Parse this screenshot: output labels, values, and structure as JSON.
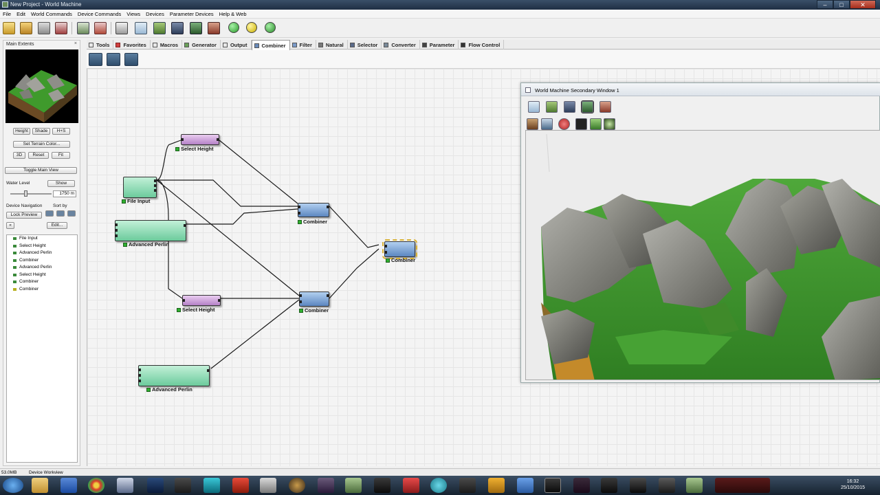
{
  "window": {
    "title": "New Project - World Machine"
  },
  "menu": [
    "File",
    "Edit",
    "World Commands",
    "Device Commands",
    "Views",
    "Devices",
    "Parameter Devices",
    "Help & Web"
  ],
  "left_panel": {
    "title": "Main Extents",
    "buttons": {
      "height": "Height",
      "shade": "Shade",
      "hs": "H+S",
      "set_terrain_color": "Set Terrain Color...",
      "b3d": "3D",
      "reset": "Reset",
      "fit": "Fit",
      "toggle_main_view": "Toggle Main View",
      "show": "Show",
      "lock_preview": "Lock Preview",
      "edit": "Edit..."
    },
    "water_level_label": "Water Level",
    "water_level_value": "1750 m",
    "device_navigation_label": "Device Navigation",
    "sort_by_label": "Sort by",
    "device_list": [
      "File Input",
      "Select Height",
      "Advanced Perlin",
      "Combiner",
      "Advanced Perlin",
      "Select Height",
      "Combiner",
      "Combiner"
    ]
  },
  "tabs": [
    "Tools",
    "Favorites",
    "Macros",
    "Generator",
    "Output",
    "Combiner",
    "Filter",
    "Natural",
    "Selector",
    "Converter",
    "Parameter",
    "Flow Control"
  ],
  "active_tab": "Combiner",
  "nodes": {
    "select_height_1": "Select Height",
    "file_input": "File Input",
    "advanced_perlin_1": "Advanced Perlin",
    "combiner_1": "Combiner",
    "combiner_selected": "Combiner",
    "select_height_2": "Select Height",
    "combiner_2": "Combiner",
    "advanced_perlin_2": "Advanced Perlin"
  },
  "secondary_window": {
    "title": "World Machine Secondary Window 1"
  },
  "status": {
    "memory": "53.0MB",
    "view": "Device Workview"
  },
  "taskbar": {
    "time": "16:32",
    "date": "25/10/2015"
  },
  "colors": {
    "node_generator": "#6ccb9c",
    "node_selector": "#b582c8",
    "node_combiner": "#5c86c0",
    "terrain_grass": "#3f9a2c",
    "terrain_rock": "#8a8a86"
  }
}
